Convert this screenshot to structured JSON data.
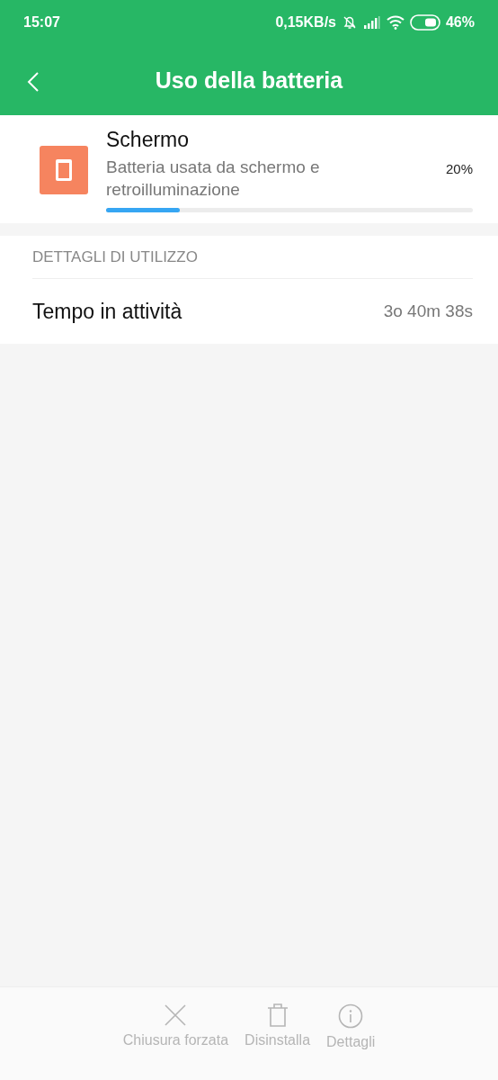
{
  "status_bar": {
    "time": "15:07",
    "speed": "0,15KB/s",
    "battery": "46%"
  },
  "header": {
    "title": "Uso della batteria"
  },
  "summary": {
    "title": "Schermo",
    "subtitle": "Batteria usata da schermo e retroilluminazione",
    "percent": "20%",
    "level": 0.2
  },
  "details": {
    "heading": "DETTAGLI DI UTILIZZO",
    "rows": [
      {
        "label": "Tempo in attività",
        "value": "3o 40m 38s"
      }
    ]
  },
  "actions": [
    {
      "kind": "close",
      "label": "Chiusura forzata",
      "disabled": true
    },
    {
      "kind": "trash",
      "label": "Disinstalla",
      "disabled": true
    },
    {
      "kind": "info",
      "label": "Dettagli",
      "disabled": true
    }
  ]
}
